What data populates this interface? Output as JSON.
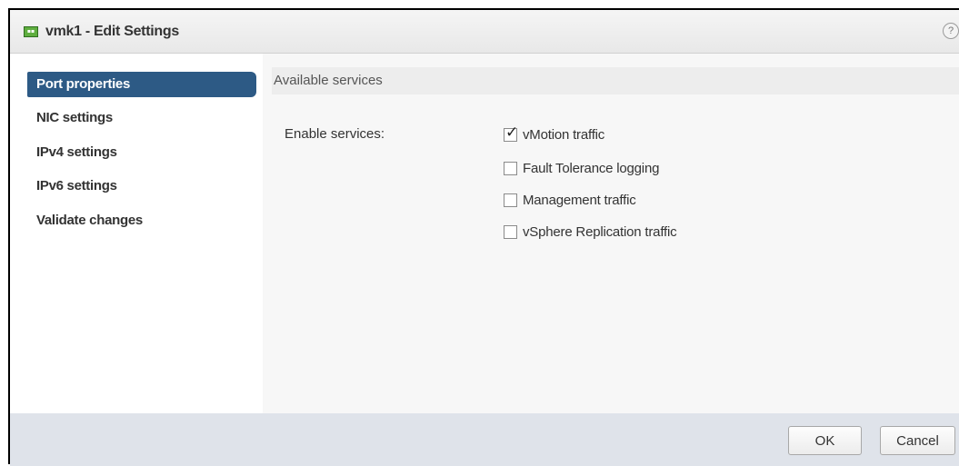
{
  "window": {
    "title": "vmk1 - Edit Settings",
    "icon": "vmk-nic-icon",
    "help_icon": "help-icon",
    "help_glyph": "?"
  },
  "sidebar": {
    "items": [
      {
        "label": "Port properties",
        "selected": true
      },
      {
        "label": "NIC settings",
        "selected": false
      },
      {
        "label": "IPv4 settings",
        "selected": false
      },
      {
        "label": "IPv6 settings",
        "selected": false
      },
      {
        "label": "Validate changes",
        "selected": false
      }
    ]
  },
  "content": {
    "section_title": "Available services",
    "field_label": "Enable services:",
    "services": [
      {
        "label": "vMotion traffic",
        "checked": true
      },
      {
        "label": "Fault Tolerance logging",
        "checked": false
      },
      {
        "label": "Management traffic",
        "checked": false
      },
      {
        "label": "vSphere Replication traffic",
        "checked": false
      }
    ]
  },
  "footer": {
    "ok_label": "OK",
    "cancel_label": "Cancel"
  },
  "colors": {
    "selected_nav_bg": "#2d5a85",
    "footer_bg": "#dfe3ea",
    "content_bg": "#f7f7f7"
  }
}
